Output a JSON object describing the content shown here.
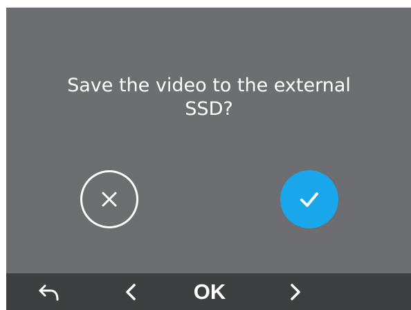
{
  "dialog": {
    "prompt_line1": "Save the video to the external",
    "prompt_line2": "SSD?",
    "cancel_icon": "close-circle-icon",
    "confirm_icon": "checkmark-icon",
    "confirm_color": "#1aa6ea",
    "background_color": "#6d6e71"
  },
  "bottom_bar": {
    "back_icon": "back-arrow-icon",
    "prev_icon": "chevron-left-icon",
    "ok_label": "OK",
    "next_icon": "chevron-right-icon",
    "background_color": "#3e3f41"
  }
}
